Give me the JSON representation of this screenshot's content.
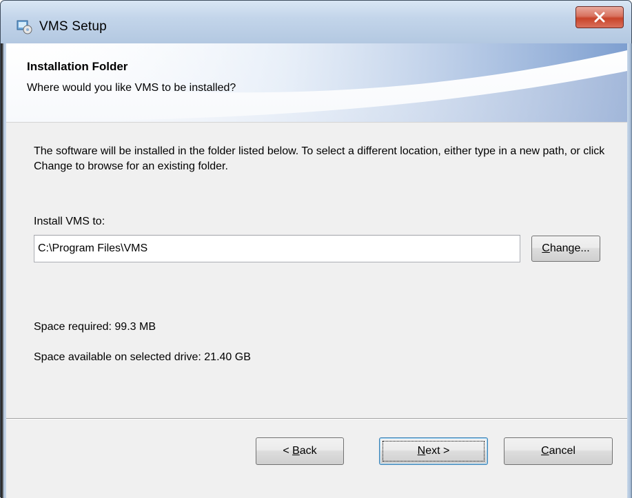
{
  "window": {
    "title": "VMS Setup",
    "close_label": "x"
  },
  "header": {
    "title": "Installation Folder",
    "subtitle": "Where would you like VMS to be installed?"
  },
  "body": {
    "description": "The software will be installed in the folder listed below. To select a different location, either type in a new path, or click Change to browse for an existing folder.",
    "install_label": "Install VMS to:",
    "install_path": "C:\\Program Files\\VMS",
    "change_button": {
      "mnemonic": "C",
      "rest": "hange..."
    },
    "space_required": "Space required: 99.3 MB",
    "space_available": "Space available on selected drive: 21.40 GB"
  },
  "footer": {
    "back_button": {
      "prefix": "< ",
      "mnemonic": "B",
      "rest": "ack"
    },
    "next_button": {
      "mnemonic": "N",
      "rest": "ext >"
    },
    "cancel_button": {
      "mnemonic": "C",
      "rest": "ancel"
    }
  },
  "colors": {
    "titlebar": "#c3d5ea",
    "close_button": "#c8442a",
    "dialog_background": "#f0f0f0",
    "default_button_border": "#3c7fb1"
  }
}
